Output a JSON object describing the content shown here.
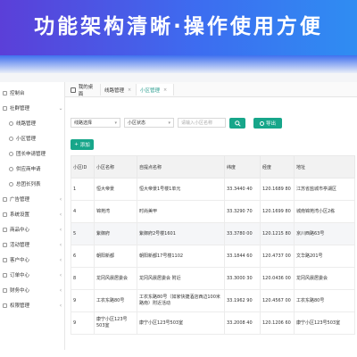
{
  "banner": {
    "title": "功能架构清晰·操作使用方便"
  },
  "sidebar": {
    "items": [
      {
        "label": "控制台",
        "arrow": ""
      },
      {
        "label": "社群管理",
        "arrow": "⌄"
      },
      {
        "label": "线路管理",
        "arrow": "",
        "sub": true
      },
      {
        "label": "小区管理",
        "arrow": "",
        "sub": true
      },
      {
        "label": "团长申请管理",
        "arrow": "",
        "sub": true
      },
      {
        "label": "供应商申请",
        "arrow": "",
        "sub": true
      },
      {
        "label": "总团长列表",
        "arrow": "",
        "sub": true
      },
      {
        "label": "广告管理",
        "arrow": "‹"
      },
      {
        "label": "系统设置",
        "arrow": "‹"
      },
      {
        "label": "商品中心",
        "arrow": "‹"
      },
      {
        "label": "活动管理",
        "arrow": "‹"
      },
      {
        "label": "客户中心",
        "arrow": "‹"
      },
      {
        "label": "订单中心",
        "arrow": "‹"
      },
      {
        "label": "财务中心",
        "arrow": "‹"
      },
      {
        "label": "权限管理",
        "arrow": "‹"
      }
    ]
  },
  "tabs": [
    {
      "label": "我的桌面",
      "close": ""
    },
    {
      "label": "线路管理",
      "close": "×"
    },
    {
      "label": "小区管理",
      "close": "×"
    }
  ],
  "filters": {
    "route_select": "线路选择",
    "status_select": "小区状态",
    "search_placeholder": "请输入小区名称",
    "export_label": "导出",
    "add_label": "添加"
  },
  "table": {
    "headers": [
      "小区ID",
      "小区名称",
      "自提点名称",
      "纬度",
      "经度",
      "地址"
    ],
    "rows": [
      {
        "id": "1",
        "name": "恒大帝景",
        "pickup": "恒大帝景1号楼1单元",
        "lat": "33.3440 40",
        "lng": "120.1689 80",
        "addr": "江苏省盐城市亭湖区"
      },
      {
        "id": "4",
        "name": "锦苑湾",
        "pickup": "时尚美甲",
        "lat": "33.3290 70",
        "lng": "120.1699 80",
        "addr": "城南锦苑湾小区2栋"
      },
      {
        "id": "5",
        "name": "紫御府",
        "pickup": "紫御府2号楼1601",
        "lat": "33.3780 00",
        "lng": "120.1215 80",
        "addr": "京川西路63号"
      },
      {
        "id": "6",
        "name": "朝阳新都",
        "pickup": "朝阳新都17号楼1102",
        "lat": "33.1844 60",
        "lng": "120.4737 00",
        "addr": "文华路201号"
      },
      {
        "id": "8",
        "name": "龙冈风晨居委会",
        "pickup": "龙冈风晨居委会 附近",
        "lat": "33.3000 30",
        "lng": "120.0436 00",
        "addr": "龙冈风晨居委会"
      },
      {
        "id": "9",
        "name": "工农东路80号",
        "pickup": "工农东路80号（如家快捷酒店西边100米路南）附近活动",
        "lat": "33.1962 90",
        "lng": "120.4567 00",
        "addr": "工农东路80号"
      },
      {
        "id": "9",
        "name": "康宁小区123号503室",
        "pickup": "康宁小区123号503室",
        "lat": "33.2008 40",
        "lng": "120.1206 60",
        "addr": "康宁小区123号503室"
      }
    ]
  }
}
